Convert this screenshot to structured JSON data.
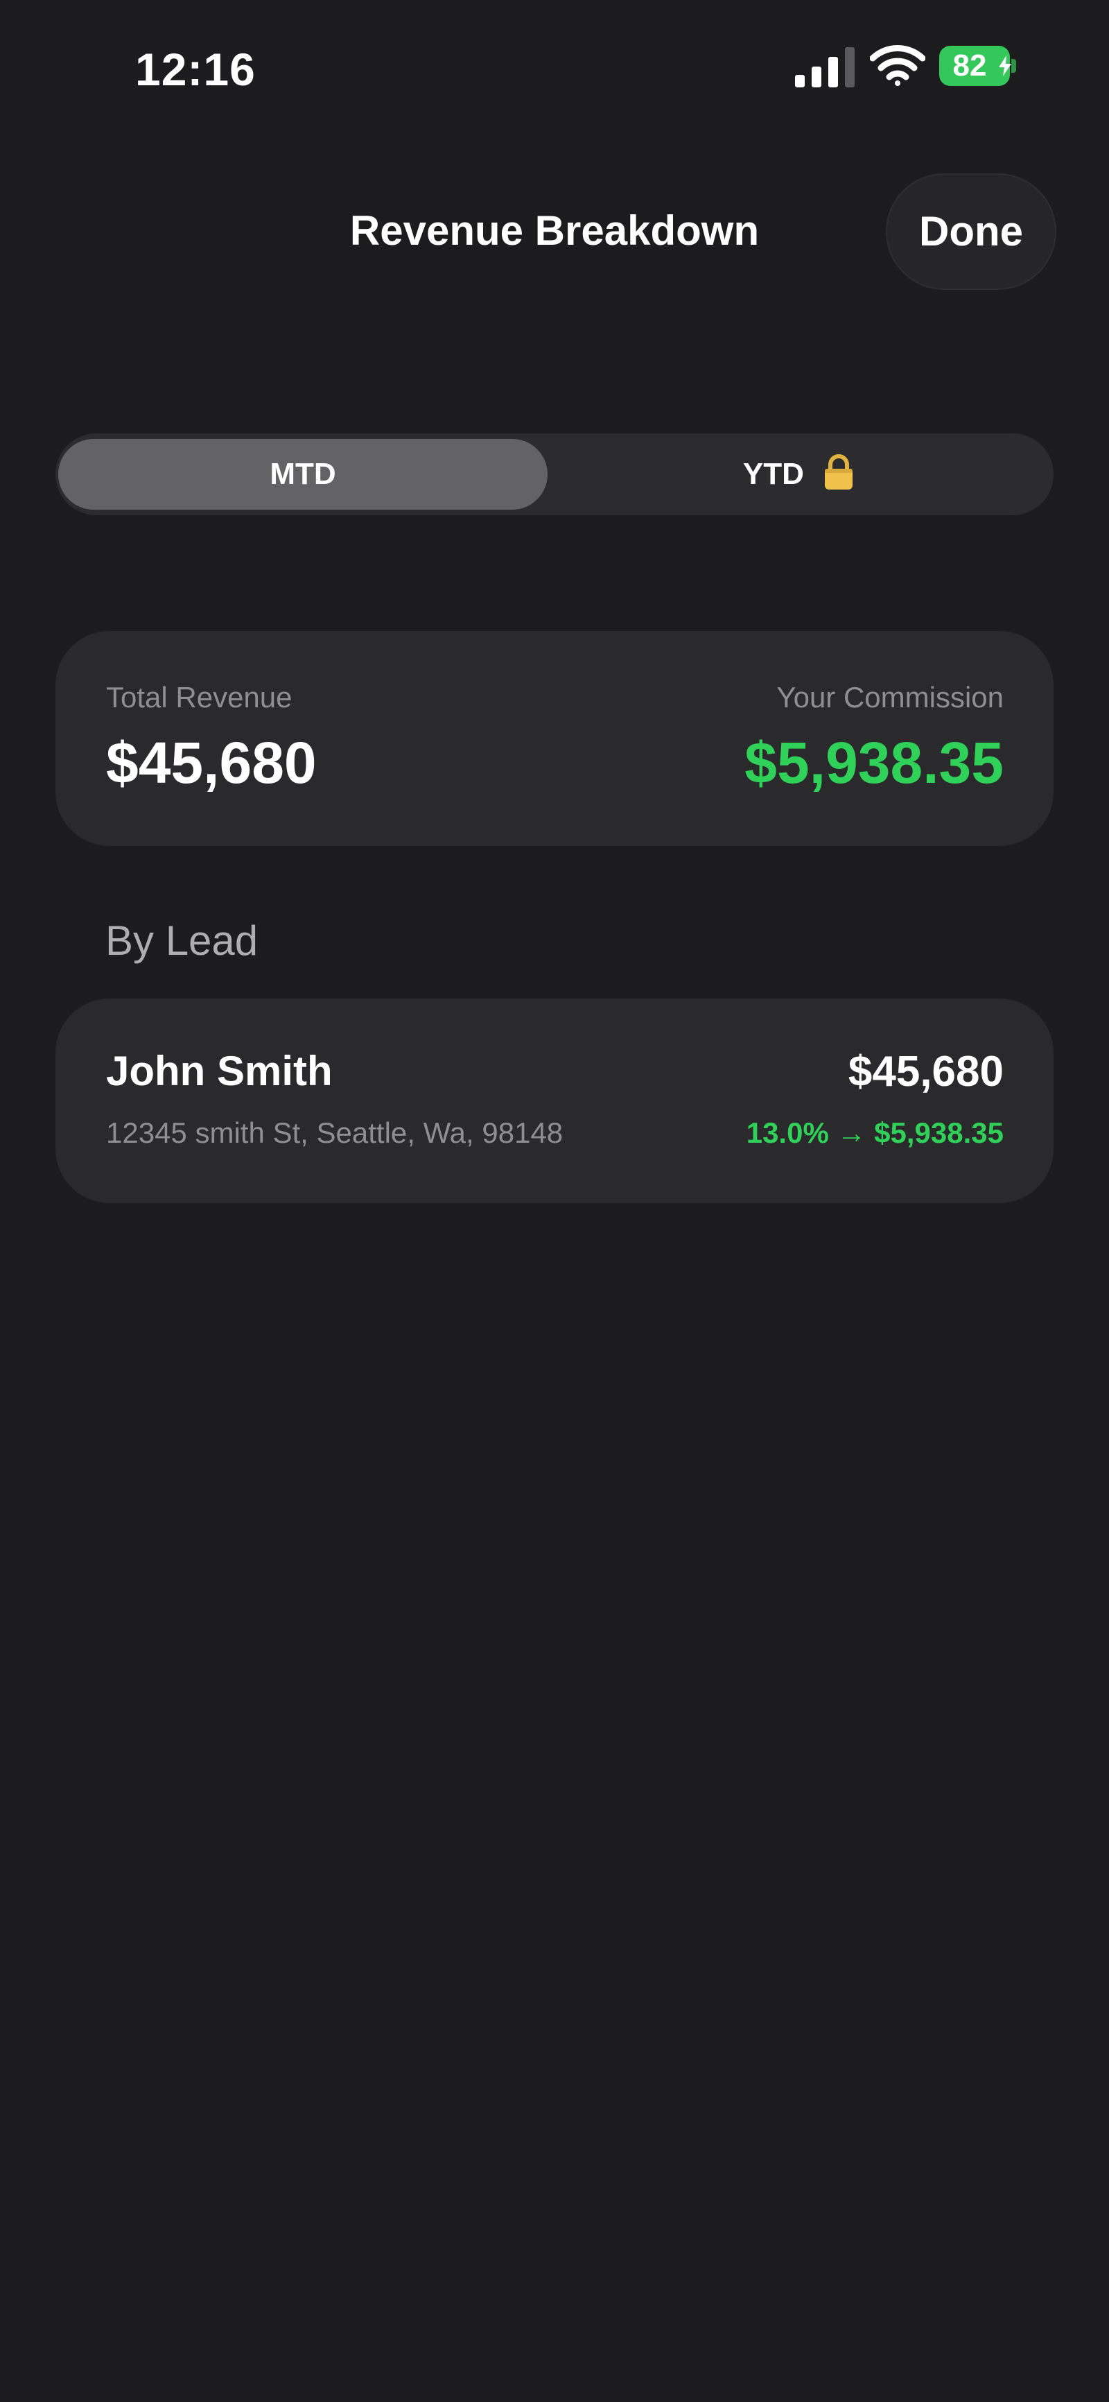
{
  "status_bar": {
    "time": "12:16",
    "battery_level": "82"
  },
  "nav": {
    "title": "Revenue Breakdown",
    "done_label": "Done"
  },
  "segmented_control": {
    "segments": [
      {
        "label": "MTD",
        "selected": true,
        "locked": false
      },
      {
        "label": "YTD",
        "selected": false,
        "locked": true
      }
    ]
  },
  "summary": {
    "total_label": "Total Revenue",
    "total_value": "$45,680",
    "commission_label": "Your Commission",
    "commission_value": "$5,938.35"
  },
  "by_lead": {
    "header": "By Lead",
    "leads": [
      {
        "name": "John Smith",
        "address": "12345 smith St, Seattle, Wa, 98148",
        "amount": "$45,680",
        "commission": "13.0% → $5,938.35"
      }
    ]
  },
  "colors": {
    "background": "#1c1c1e",
    "card": "#2a2a2c",
    "accent_green": "#30d158",
    "secondary_text": "#8e8e93",
    "segment_selected": "#636366"
  },
  "icons": [
    "cellular-signal-icon",
    "wifi-icon",
    "battery-icon",
    "charging-bolt-icon",
    "lock-icon"
  ]
}
